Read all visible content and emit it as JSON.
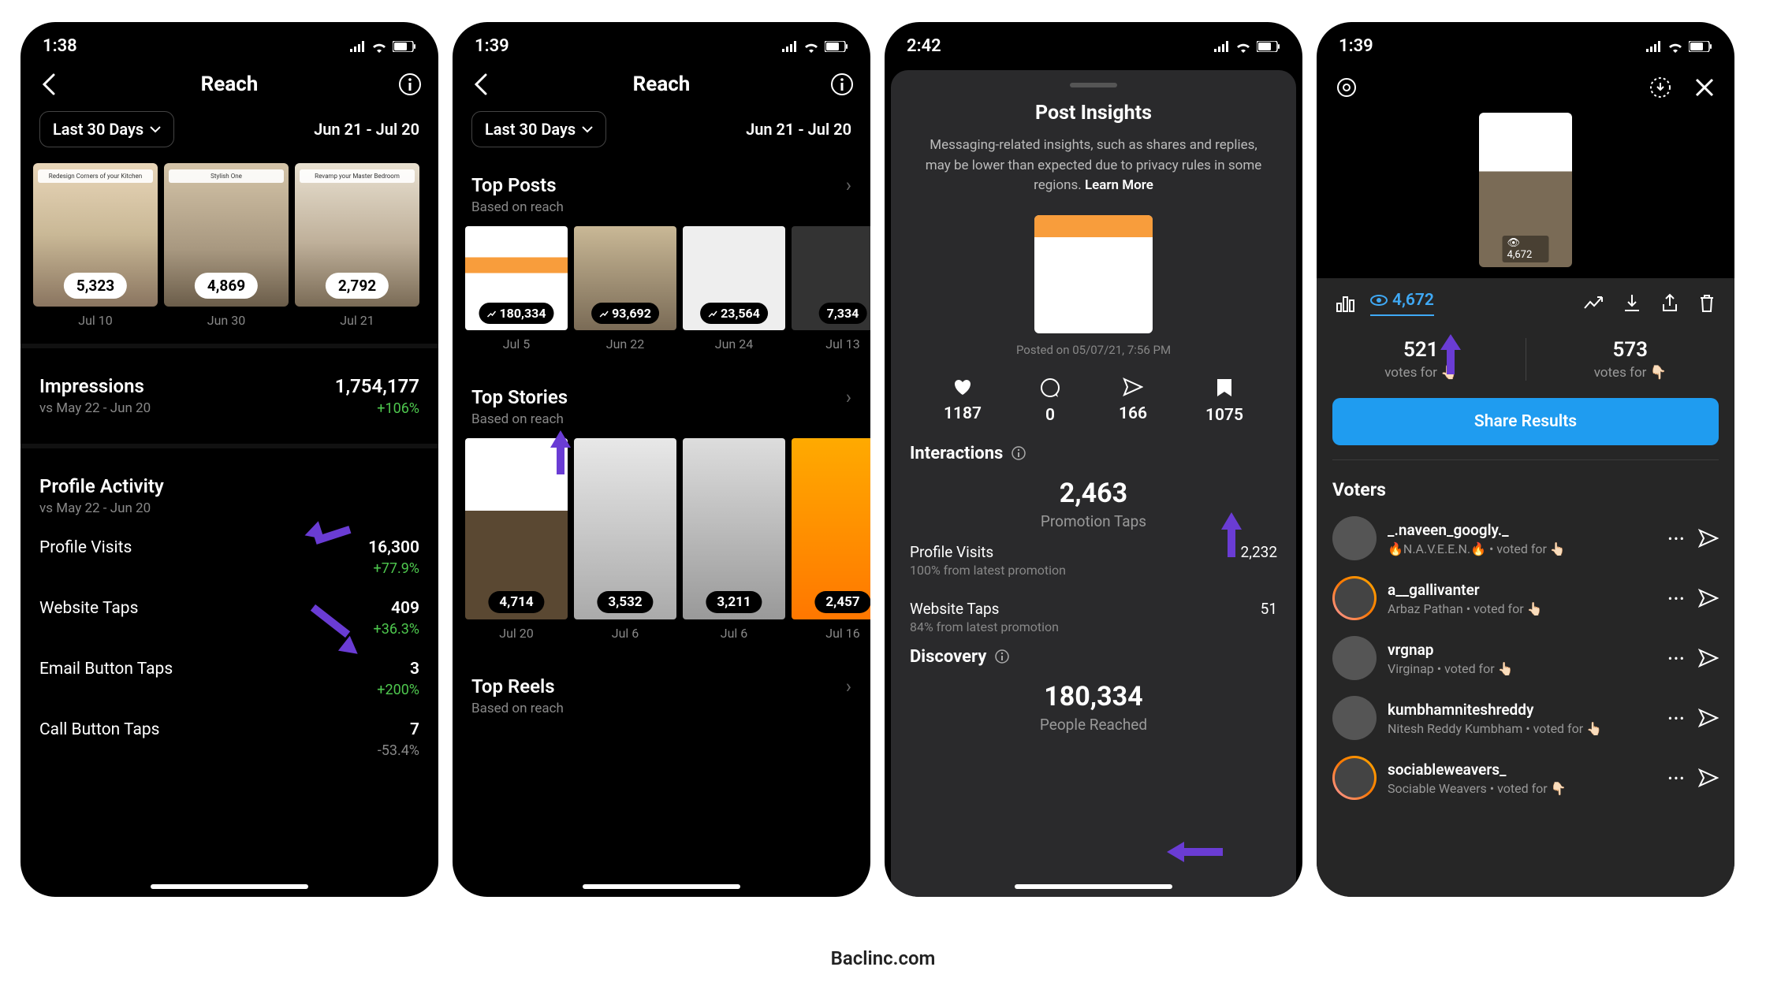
{
  "footer": "Baclinc.com",
  "phone1": {
    "time": "1:38",
    "title": "Reach",
    "filter": "Last 30 Days",
    "range": "Jun 21 - Jul 20",
    "thumbs": [
      {
        "banner": "Redesign Corners of your Kitchen",
        "val": "5,323",
        "date": "Jul 10"
      },
      {
        "banner": "Stylish One",
        "val": "4,869",
        "date": "Jun 30"
      },
      {
        "banner": "Revamp your Master Bedroom",
        "val": "2,792",
        "date": "Jul 21"
      }
    ],
    "impressions": {
      "label": "Impressions",
      "sub": "vs May 22 - Jun 20",
      "val": "1,754,177",
      "change": "+106%"
    },
    "profile_activity": {
      "label": "Profile Activity",
      "sub": "vs May 22 - Jun 20"
    },
    "rows": [
      {
        "label": "Profile Visits",
        "val": "16,300",
        "change": "+77.9%",
        "cls": "green"
      },
      {
        "label": "Website Taps",
        "val": "409",
        "change": "+36.3%",
        "cls": "green"
      },
      {
        "label": "Email Button Taps",
        "val": "3",
        "change": "+200%",
        "cls": "green"
      },
      {
        "label": "Call Button Taps",
        "val": "7",
        "change": "-53.4%",
        "cls": "gray"
      }
    ]
  },
  "phone2": {
    "time": "1:39",
    "title": "Reach",
    "filter": "Last 30 Days",
    "range": "Jun 21 - Jul 20",
    "top_posts": {
      "title": "Top Posts",
      "sub": "Based on reach"
    },
    "posts": [
      {
        "val": "180,334",
        "date": "Jul 5"
      },
      {
        "val": "93,692",
        "date": "Jun 22"
      },
      {
        "val": "23,564",
        "date": "Jun 24"
      },
      {
        "val": "7,334",
        "date": "Jul 13"
      }
    ],
    "top_stories": {
      "title": "Top Stories",
      "sub": "Based on reach"
    },
    "stories": [
      {
        "val": "4,714",
        "date": "Jul 20"
      },
      {
        "val": "3,532",
        "date": "Jul 6"
      },
      {
        "val": "3,211",
        "date": "Jul 6"
      },
      {
        "val": "2,457",
        "date": "Jul 16"
      }
    ],
    "top_reels": {
      "title": "Top Reels",
      "sub": "Based on reach"
    }
  },
  "phone3": {
    "time": "2:42",
    "sheet_title": "Post Insights",
    "notice": "Messaging-related insights, such as shares and replies, may be lower than expected due to privacy rules in some regions.",
    "learn_more": "Learn More",
    "posted": "Posted on 05/07/21, 7:56 PM",
    "engage": {
      "likes": "1187",
      "comments": "0",
      "shares": "166",
      "saves": "1075"
    },
    "interactions_label": "Interactions",
    "interactions": {
      "val": "2,463",
      "label": "Promotion Taps"
    },
    "profile_visits": {
      "label": "Profile Visits",
      "val": "2,232",
      "sub": "100% from latest promotion"
    },
    "website_taps": {
      "label": "Website Taps",
      "val": "51",
      "sub": "84% from latest promotion"
    },
    "discovery_label": "Discovery",
    "discovery": {
      "val": "180,334",
      "label": "People Reached"
    }
  },
  "phone4": {
    "time": "1:39",
    "story_views": "4,672",
    "views_display": "4,672",
    "votes": {
      "up": {
        "val": "521",
        "label": "votes for 👆🏻"
      },
      "down": {
        "val": "573",
        "label": "votes for 👇🏻"
      }
    },
    "share_btn": "Share Results",
    "voters_title": "Voters",
    "voters": [
      {
        "user": "_.naveen_googly._",
        "detail": "🔥N.A.V.E.E.N.🔥 • voted for 👆🏻",
        "ring": false
      },
      {
        "user": "a__gallivanter",
        "detail": "Arbaz Pathan • voted for 👆🏻",
        "ring": true
      },
      {
        "user": "vrgnap",
        "detail": "Virginap • voted for 👆🏻",
        "ring": false
      },
      {
        "user": "kumbhamniteshreddy",
        "detail": "Nitesh Reddy Kumbham • voted for 👆🏻",
        "ring": false
      },
      {
        "user": "sociableweavers_",
        "detail": "Sociable Weavers • voted for 👇🏻",
        "ring": true
      }
    ]
  }
}
